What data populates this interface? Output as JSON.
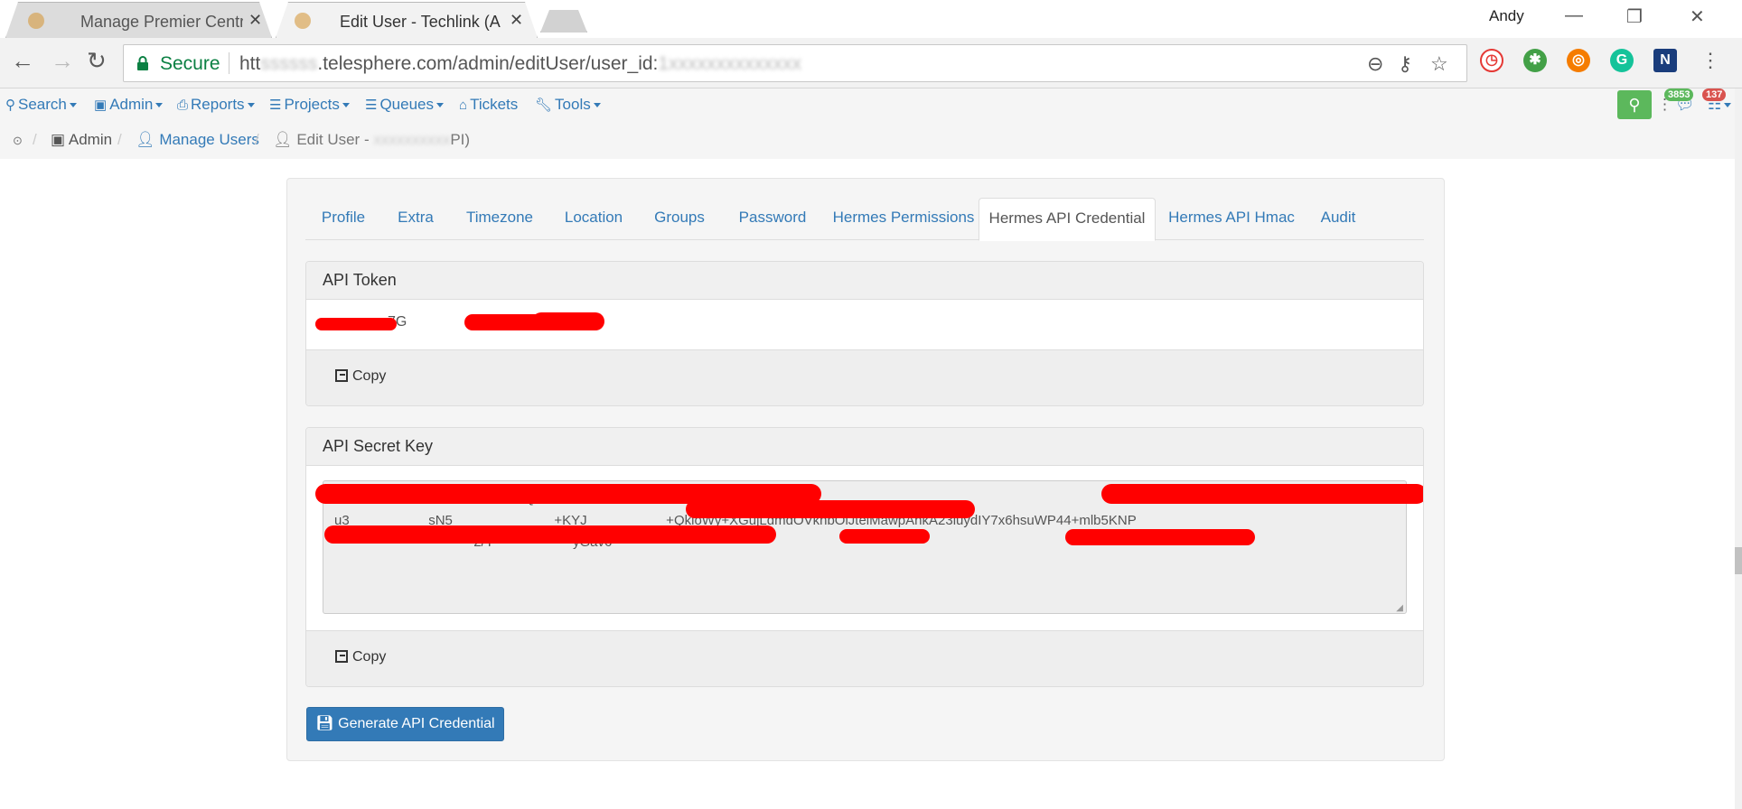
{
  "browser": {
    "tabs": [
      {
        "title": "Manage Premier Centr",
        "active": false
      },
      {
        "title": "Edit User - Techlink (A",
        "active": true
      }
    ],
    "user": "Andy",
    "secure_label": "Secure",
    "url_prefix": "htt",
    "url_main": ".telesphere.com/admin/editUser/user_id:",
    "extensions": [
      {
        "icon": "clock-icon",
        "color": "#e53935",
        "glyph": "◷"
      },
      {
        "icon": "gear-icon",
        "color": "#43a047",
        "glyph": "✱"
      },
      {
        "icon": "lifebuoy-icon",
        "color": "#f57c00",
        "glyph": "◎"
      },
      {
        "icon": "grammarly-icon",
        "color": "#15c39a",
        "glyph": "G"
      },
      {
        "icon": "n-icon",
        "color": "#1a3d7c",
        "glyph": "N"
      }
    ]
  },
  "navbar": {
    "items": [
      "Search",
      "Admin",
      "Reports",
      "Projects",
      "Queues",
      "Tickets",
      "Tools"
    ],
    "badge_messages": "3853",
    "badge_alerts": "137"
  },
  "breadcrumb": {
    "admin": "Admin",
    "manage_users": "Manage Users",
    "edit_user_prefix": "Edit User - ",
    "edit_user_suffix": "PI)"
  },
  "tabs": [
    "Profile",
    "Extra",
    "Timezone",
    "Location",
    "Groups",
    "Password",
    "Hermes Permissions",
    "Hermes API Credential",
    "Hermes API Hmac",
    "Audit"
  ],
  "active_tab": "Hermes API Credential",
  "api_token": {
    "heading": "API Token",
    "value": "7G",
    "copy_label": "Copy"
  },
  "api_secret": {
    "heading": "API Secret Key",
    "line1": "R                                        bs60Q/U                                   TixCSNc",
    "line2": "u3                     sN5                           +KYJ                     +QkioWy+XGujLdmdOVkhbOlJtelMawpAnkA23luydIY7x6hsuWP44+mlb5KNP",
    "line3": "                                     2/Y                     yGav6",
    "copy_label": "Copy"
  },
  "generate_button": "Generate API Credential"
}
